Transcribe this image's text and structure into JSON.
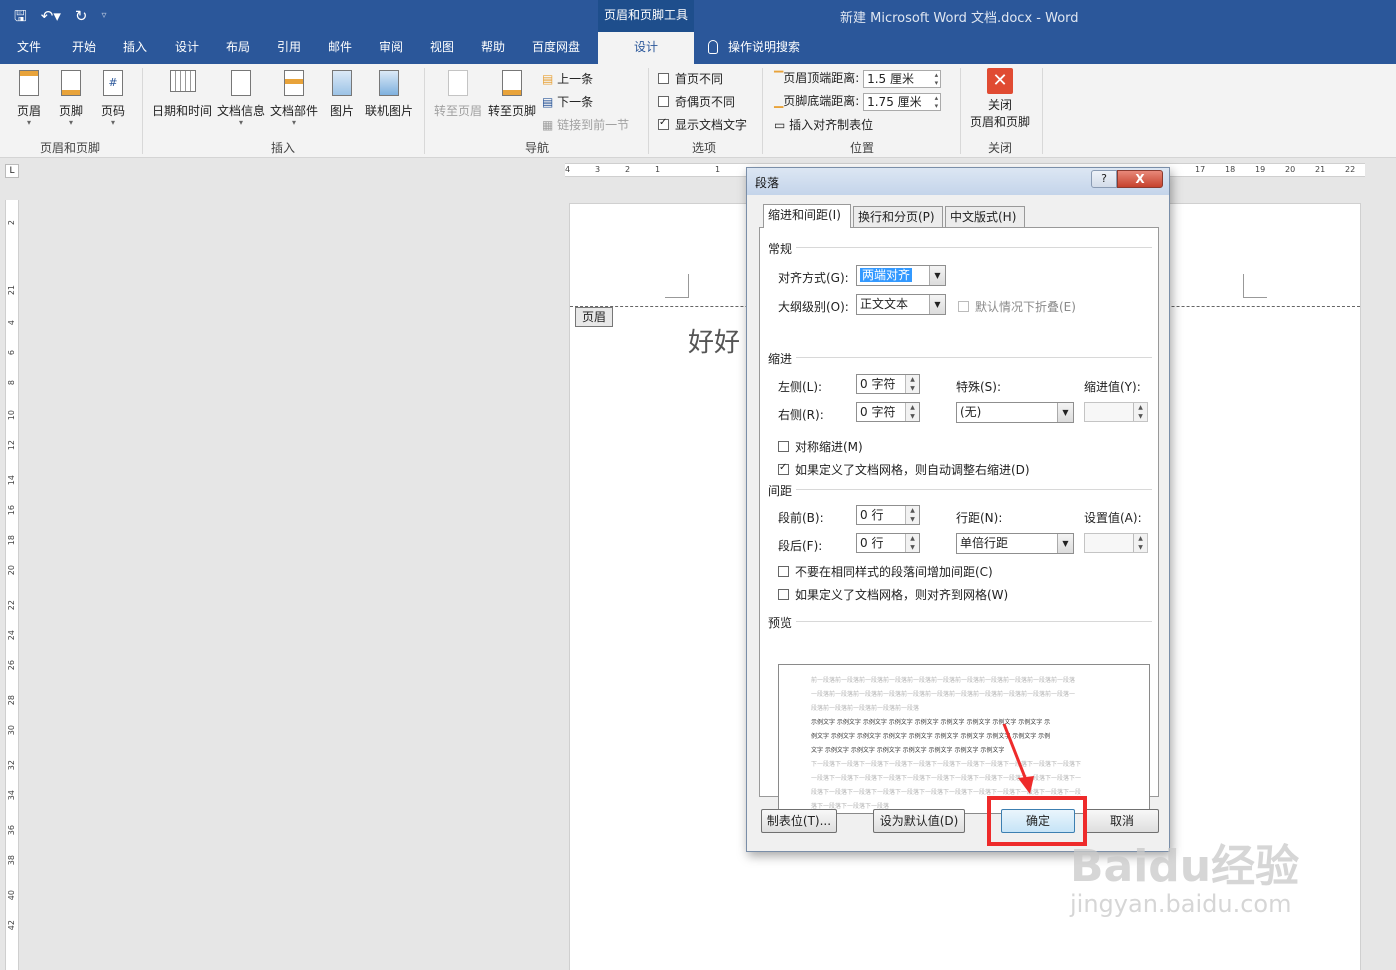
{
  "window": {
    "context_tab": "页眉和页脚工具",
    "title": "新建 Microsoft Word 文档.docx  -  Word"
  },
  "qat": {
    "save": "save-icon",
    "undo": "undo-icon",
    "redo": "redo-icon"
  },
  "tabs": [
    "文件",
    "开始",
    "插入",
    "设计",
    "布局",
    "引用",
    "邮件",
    "审阅",
    "视图",
    "帮助",
    "百度网盘",
    "设计"
  ],
  "tell_me": "操作说明搜索",
  "ribbon": {
    "hf_group": {
      "label": "页眉和页脚",
      "header": "页眉",
      "footer": "页脚",
      "page_number": "页码"
    },
    "insert_group": {
      "label": "插入",
      "datetime": "日期和时间",
      "docinfo": "文档信息",
      "parts": "文档部件",
      "picture": "图片",
      "online_picture": "联机图片"
    },
    "nav_group": {
      "label": "导航",
      "goto_header": "转至页眉",
      "goto_footer": "转至页脚",
      "prev": "上一条",
      "next": "下一条",
      "link_prev": "链接到前一节"
    },
    "options_group": {
      "label": "选项",
      "first_page": "首页不同",
      "odd_even": "奇偶页不同",
      "show_text": "显示文档文字"
    },
    "position_group": {
      "label": "位置",
      "header_dist_label": "页眉顶端距离:",
      "header_dist": "1.5 厘米",
      "footer_dist_label": "页脚底端距离:",
      "footer_dist": "1.75 厘米",
      "align_tab": "插入对齐制表位"
    },
    "close_group": {
      "label": "关闭",
      "close_line1": "关闭",
      "close_line2": "页眉和页脚"
    }
  },
  "ruler": {
    "h": [
      "4",
      "3",
      "2",
      "1",
      "1",
      "17",
      "18",
      "19",
      "20",
      "21",
      "22"
    ],
    "v": [
      "2",
      "1",
      "2",
      "4",
      "6",
      "8",
      "10",
      "12",
      "14",
      "16",
      "18",
      "20",
      "22",
      "24",
      "26",
      "28",
      "30",
      "32",
      "34",
      "36",
      "38",
      "40",
      "42"
    ]
  },
  "page": {
    "header_tag": "页眉",
    "text": "好好"
  },
  "dialog": {
    "title": "段落",
    "help": "?",
    "close": "X",
    "tabs": [
      "缩进和间距(I)",
      "换行和分页(P)",
      "中文版式(H)"
    ],
    "general": {
      "title": "常规",
      "align_label": "对齐方式(G):",
      "align_value": "两端对齐",
      "outline_label": "大纲级别(O):",
      "outline_value": "正文文本",
      "collapse_label": "默认情况下折叠(E)"
    },
    "indent": {
      "title": "缩进",
      "left_label": "左侧(L):",
      "left_value": "0 字符",
      "right_label": "右侧(R):",
      "right_value": "0 字符",
      "special_label": "特殊(S):",
      "special_value": "(无)",
      "indent_value_label": "缩进值(Y):",
      "mirror_label": "对称缩进(M)",
      "auto_adjust_label": "如果定义了文档网格，则自动调整右缩进(D)"
    },
    "spacing": {
      "title": "间距",
      "before_label": "段前(B):",
      "before_value": "0 行",
      "after_label": "段后(F):",
      "after_value": "0 行",
      "line_label": "行距(N):",
      "line_value": "单倍行距",
      "set_value_label": "设置值(A):",
      "no_space_label": "不要在相同样式的段落间增加间距(C)",
      "snap_grid_label": "如果定义了文档网格，则对齐到网格(W)"
    },
    "preview": {
      "title": "预览",
      "prev_lines": [
        "前一段落前一段落前一段落前一段落前一段落前一段落前一段落前一段落前一段落前一段落前一段落",
        "一段落前一段落前一段落前一段落前一段落前一段落前一段落前一段落前一段落前一段落前一段落一",
        "段落前一段落前一段落前一段落前一段落"
      ],
      "sample_lines": [
        "示例文字 示例文字 示例文字 示例文字 示例文字 示例文字 示例文字 示例文字 示例文字 示",
        "例文字 示例文字 示例文字 示例文字 示例文字 示例文字 示例文字 示例文字 示例文字 示例",
        "文字 示例文字 示例文字 示例文字 示例文字 示例文字 示例文字 示例文字"
      ],
      "next_lines": [
        "下一段落下一段落下一段落下一段落下一段落下一段落下一段落下一段落下一段落下一段落下一段落下",
        "一段落下一段落下一段落下一段落下一段落下一段落下一段落下一段落下一段落下一段落下一段落下一",
        "段落下一段落下一段落下一段落下一段落下一段落下一段落下一段落下一段落下一段落下一段落下一段",
        "落下一段落下一段落下一段落"
      ]
    },
    "buttons": {
      "tabs": "制表位(T)...",
      "default": "设为默认值(D)",
      "ok": "确定",
      "cancel": "取消"
    }
  },
  "watermark": {
    "main": "Baidu经验",
    "sub": "jingyan.baidu.com"
  },
  "colors": {
    "word_blue": "#2b579a",
    "highlight_red": "#ee2b2b"
  }
}
